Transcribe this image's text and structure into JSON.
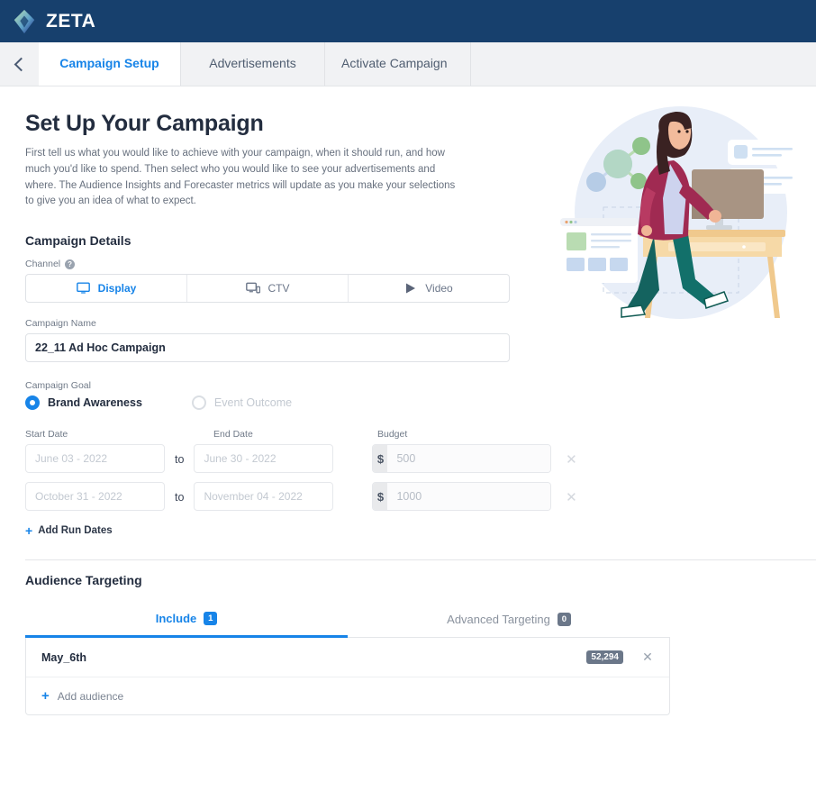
{
  "brand": {
    "name": "ZETA",
    "logo_icon": "zeta-diamond-logo",
    "bar_color": "#17406d"
  },
  "nav": {
    "back_icon": "chevron-left-icon",
    "tabs": [
      {
        "label": "Campaign Setup",
        "active": true
      },
      {
        "label": "Advertisements",
        "active": false
      },
      {
        "label": "Activate Campaign",
        "active": false
      }
    ]
  },
  "page": {
    "title": "Set Up Your Campaign",
    "subtitle": "First tell us what you would like to achieve with your campaign, when it should run, and how much you'd like to spend. Then select who you would like to see your advertisements and where. The Audience Insights and Forecaster metrics will update as you make your selections to give you an idea of what to expect."
  },
  "campaign_details": {
    "heading": "Campaign Details",
    "channel": {
      "label": "Channel",
      "help_icon": "help-circle-icon",
      "options": [
        {
          "label": "Display",
          "icon": "monitor-icon",
          "selected": true
        },
        {
          "label": "CTV",
          "icon": "tv-device-icon",
          "selected": false
        },
        {
          "label": "Video",
          "icon": "play-triangle-icon",
          "selected": false
        }
      ]
    },
    "campaign_name": {
      "label": "Campaign Name",
      "value": "22_11 Ad Hoc Campaign",
      "placeholder": "Campaign Name"
    },
    "campaign_goal": {
      "label": "Campaign Goal",
      "options": [
        {
          "label": "Brand Awareness",
          "selected": true,
          "disabled": false
        },
        {
          "label": "Event Outcome",
          "selected": false,
          "disabled": true
        }
      ]
    },
    "run_dates": {
      "start_label": "Start Date",
      "end_label": "End Date",
      "budget_label": "Budget",
      "to_word": "to",
      "calendar_icon": "calendar-icon",
      "remove_icon": "close-x-icon",
      "currency_symbol": "$",
      "rows": [
        {
          "start_placeholder": "June 03 - 2022",
          "end_placeholder": "June 30 - 2022",
          "budget_placeholder": "500",
          "start_value": "",
          "end_value": "",
          "budget_value": ""
        },
        {
          "start_placeholder": "October 31 - 2022",
          "end_placeholder": "November 04 - 2022",
          "budget_placeholder": "1000",
          "start_value": "",
          "end_value": "",
          "budget_value": ""
        }
      ],
      "add_label": "Add Run Dates",
      "add_icon": "plus-icon"
    }
  },
  "audience_targeting": {
    "heading": "Audience Targeting",
    "tabs": [
      {
        "label": "Include",
        "count": "1",
        "active": true
      },
      {
        "label": "Advanced Targeting",
        "count": "0",
        "active": false
      }
    ],
    "audiences": [
      {
        "name": "May_6th",
        "count": "52,294",
        "remove_icon": "close-x-icon"
      }
    ],
    "add_label": "Add audience",
    "add_icon": "plus-icon"
  },
  "illustration": {
    "name": "woman-walking-by-desk-illustration"
  },
  "colors": {
    "accent": "#1784e8",
    "brand_navy": "#17406d",
    "badge_gray": "#6b7789",
    "text_dark": "#232d3f"
  }
}
